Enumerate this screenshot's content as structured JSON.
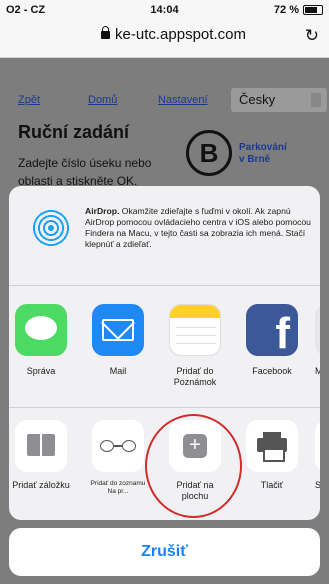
{
  "status_bar": {
    "carrier": "O2 - CZ",
    "time": "14:04",
    "battery": "72 %",
    "battery_level": 0.72
  },
  "browser": {
    "url": "ke-utc.appspot.com"
  },
  "page": {
    "nav": {
      "back": "Zpět",
      "home": "Domů",
      "settings": "Nastavení",
      "language": "Česky"
    },
    "title": "Ruční zadání",
    "body": "Zadejte číslo úseku nebo oblasti a stiskněte OK.",
    "logo_letter": "B",
    "logo_text_1": "Parkování",
    "logo_text_2": "v Brně"
  },
  "share_sheet": {
    "airdrop": {
      "title": "AirDrop.",
      "description": "Okamžite zdieľajte s ľuďmi v okolí. Ak zapnú AirDrop pomocou ovládacieho centra v iOS alebo pomocou Findera na Macu, v tejto časti sa zobrazia ich mená. Stačí klepnúť a zdieľať."
    },
    "apps": [
      {
        "label": "Správa",
        "icon": "messages-icon"
      },
      {
        "label": "Mail",
        "icon": "mail-icon"
      },
      {
        "label": "Pridať do Poznámok",
        "icon": "notes-icon"
      },
      {
        "label": "Facebook",
        "icon": "facebook-icon"
      },
      {
        "label": "M",
        "icon": "more-app-icon"
      }
    ],
    "actions": [
      {
        "label": "Pridať záložku",
        "icon": "bookmark-icon"
      },
      {
        "label": "Pridať do zoznamu Na pr...",
        "icon": "reading-list-icon"
      },
      {
        "label": "Pridať na plochu",
        "icon": "add-to-home-icon"
      },
      {
        "label": "Tlačiť",
        "icon": "print-icon"
      },
      {
        "label": "S D",
        "icon": "more-action-icon"
      }
    ],
    "cancel": "Zrušiť"
  }
}
